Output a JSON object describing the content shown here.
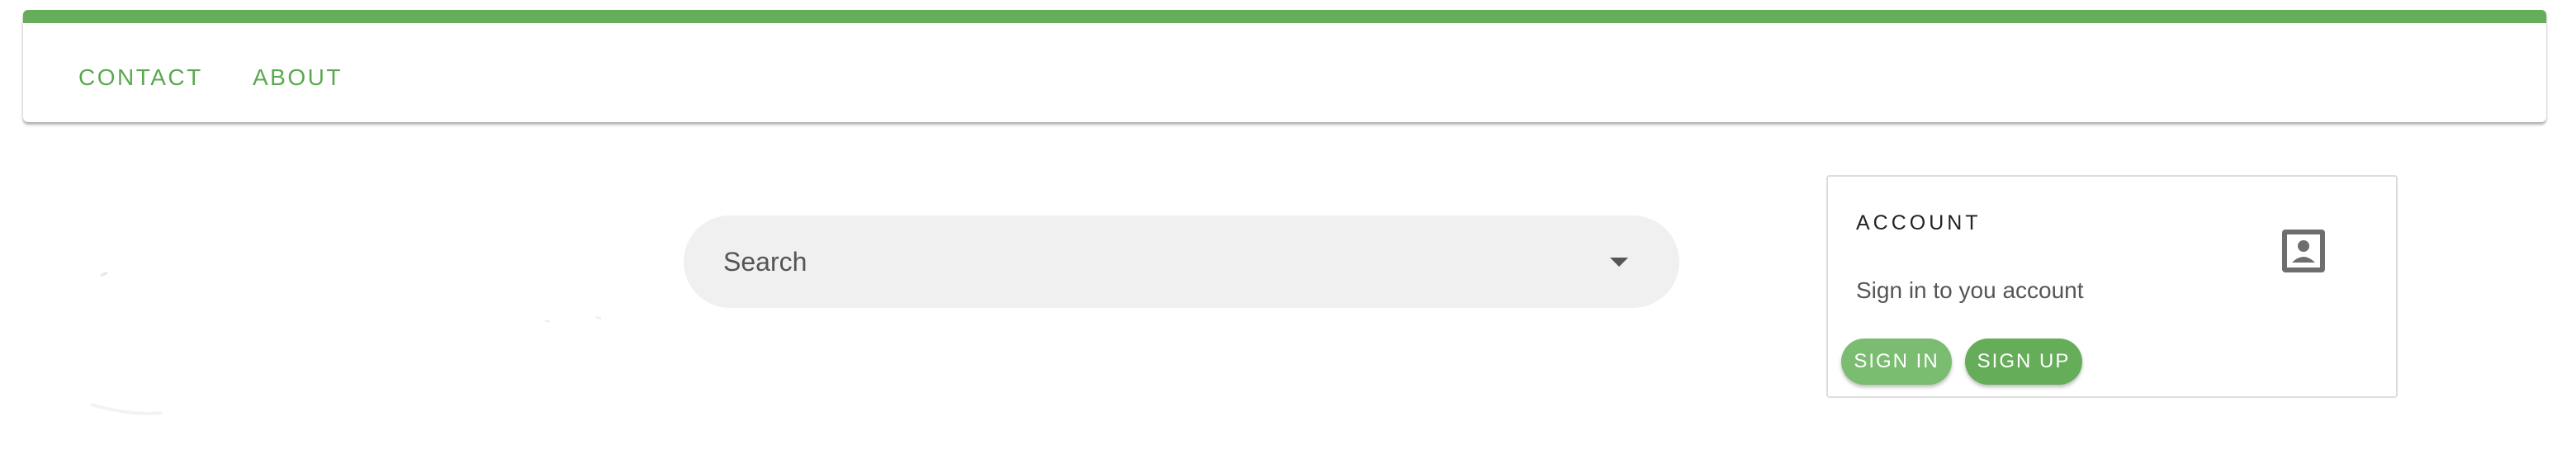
{
  "nav": {
    "contact_label": "CONTACT",
    "about_label": "ABOUT"
  },
  "search": {
    "placeholder": "Search"
  },
  "account": {
    "title": "ACCOUNT",
    "subtitle": "Sign in to you account",
    "signin_label": "SIGN IN",
    "signup_label": "SIGN UP",
    "icon": "account-box-icon"
  },
  "colors": {
    "brand_green": "#66ad5a",
    "nav_text": "#5aa84f",
    "signin_button": "#7bbd70",
    "search_background": "#f0f0f0"
  }
}
